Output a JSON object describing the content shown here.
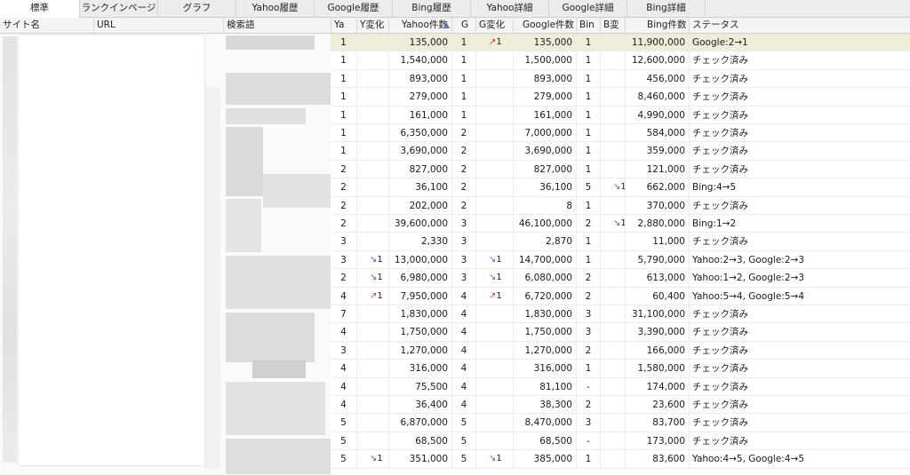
{
  "tabs": [
    "標準",
    "ランクインページ",
    "グラフ",
    "Yahoo履歴",
    "Google履歴",
    "Bing履歴",
    "Yahoo詳細",
    "Google詳細",
    "Bing詳細"
  ],
  "columns": {
    "site_name": "サイト名",
    "url": "URL",
    "keyword": "検索語",
    "yahoo_rank": "Ya",
    "yahoo_change": "Y変化",
    "yahoo_count": "Yahoo件数",
    "google_rank": "G",
    "google_change": "G変化",
    "google_count": "Google件数",
    "bing_rank": "Bin",
    "bing_change": "B変",
    "bing_count": "Bing件数",
    "status": "ステータス"
  },
  "rows": [
    {
      "ya": "1",
      "yc": "",
      "ycd": "",
      "yn": "135,000",
      "g": "1",
      "gc": "1",
      "gcd": "up",
      "gn": "135,000",
      "b": "1",
      "bc": "",
      "bcd": "",
      "bn": "11,900,000",
      "st": "Google:2→1"
    },
    {
      "ya": "1",
      "yc": "",
      "ycd": "",
      "yn": "1,540,000",
      "g": "1",
      "gc": "",
      "gcd": "",
      "gn": "1,500,000",
      "b": "1",
      "bc": "",
      "bcd": "",
      "bn": "12,600,000",
      "st": "チェック済み"
    },
    {
      "ya": "1",
      "yc": "",
      "ycd": "",
      "yn": "893,000",
      "g": "1",
      "gc": "",
      "gcd": "",
      "gn": "893,000",
      "b": "1",
      "bc": "",
      "bcd": "",
      "bn": "456,000",
      "st": "チェック済み"
    },
    {
      "ya": "1",
      "yc": "",
      "ycd": "",
      "yn": "279,000",
      "g": "1",
      "gc": "",
      "gcd": "",
      "gn": "279,000",
      "b": "1",
      "bc": "",
      "bcd": "",
      "bn": "8,460,000",
      "st": "チェック済み"
    },
    {
      "ya": "1",
      "yc": "",
      "ycd": "",
      "yn": "161,000",
      "g": "1",
      "gc": "",
      "gcd": "",
      "gn": "161,000",
      "b": "1",
      "bc": "",
      "bcd": "",
      "bn": "4,990,000",
      "st": "チェック済み"
    },
    {
      "ya": "1",
      "yc": "",
      "ycd": "",
      "yn": "6,350,000",
      "g": "2",
      "gc": "",
      "gcd": "",
      "gn": "7,000,000",
      "b": "1",
      "bc": "",
      "bcd": "",
      "bn": "584,000",
      "st": "チェック済み"
    },
    {
      "ya": "1",
      "yc": "",
      "ycd": "",
      "yn": "3,690,000",
      "g": "2",
      "gc": "",
      "gcd": "",
      "gn": "3,690,000",
      "b": "1",
      "bc": "",
      "bcd": "",
      "bn": "359,000",
      "st": "チェック済み"
    },
    {
      "ya": "2",
      "yc": "",
      "ycd": "",
      "yn": "827,000",
      "g": "2",
      "gc": "",
      "gcd": "",
      "gn": "827,000",
      "b": "1",
      "bc": "",
      "bcd": "",
      "bn": "121,000",
      "st": "チェック済み"
    },
    {
      "ya": "2",
      "yc": "",
      "ycd": "",
      "yn": "36,100",
      "g": "2",
      "gc": "",
      "gcd": "",
      "gn": "36,100",
      "b": "5",
      "bc": "1",
      "bcd": "down",
      "bn": "662,000",
      "st": "Bing:4→5"
    },
    {
      "ya": "2",
      "yc": "",
      "ycd": "",
      "yn": "202,000",
      "g": "2",
      "gc": "",
      "gcd": "",
      "gn": "8",
      "b": "1",
      "bc": "",
      "bcd": "",
      "bn": "370,000",
      "st": "チェック済み"
    },
    {
      "ya": "2",
      "yc": "",
      "ycd": "",
      "yn": "39,600,000",
      "g": "3",
      "gc": "",
      "gcd": "",
      "gn": "46,100,000",
      "b": "2",
      "bc": "1",
      "bcd": "down",
      "bn": "2,880,000",
      "st": "Bing:1→2"
    },
    {
      "ya": "3",
      "yc": "",
      "ycd": "",
      "yn": "2,330",
      "g": "3",
      "gc": "",
      "gcd": "",
      "gn": "2,870",
      "b": "1",
      "bc": "",
      "bcd": "",
      "bn": "11,000",
      "st": "チェック済み"
    },
    {
      "ya": "3",
      "yc": "1",
      "ycd": "down",
      "yn": "13,000,000",
      "g": "3",
      "gc": "1",
      "gcd": "down",
      "gn": "14,700,000",
      "b": "1",
      "bc": "",
      "bcd": "",
      "bn": "5,790,000",
      "st": "Yahoo:2→3, Google:2→3"
    },
    {
      "ya": "2",
      "yc": "1",
      "ycd": "down",
      "yn": "6,980,000",
      "g": "3",
      "gc": "1",
      "gcd": "down",
      "gn": "6,080,000",
      "b": "2",
      "bc": "",
      "bcd": "",
      "bn": "613,000",
      "st": "Yahoo:1→2, Google:2→3"
    },
    {
      "ya": "4",
      "yc": "1",
      "ycd": "up",
      "yn": "7,950,000",
      "g": "4",
      "gc": "1",
      "gcd": "up",
      "gn": "6,720,000",
      "b": "2",
      "bc": "",
      "bcd": "",
      "bn": "60,400",
      "st": "Yahoo:5→4, Google:5→4"
    },
    {
      "ya": "7",
      "yc": "",
      "ycd": "",
      "yn": "1,830,000",
      "g": "4",
      "gc": "",
      "gcd": "",
      "gn": "1,830,000",
      "b": "3",
      "bc": "",
      "bcd": "",
      "bn": "31,100,000",
      "st": "チェック済み"
    },
    {
      "ya": "4",
      "yc": "",
      "ycd": "",
      "yn": "1,750,000",
      "g": "4",
      "gc": "",
      "gcd": "",
      "gn": "1,750,000",
      "b": "3",
      "bc": "",
      "bcd": "",
      "bn": "3,390,000",
      "st": "チェック済み"
    },
    {
      "ya": "3",
      "yc": "",
      "ycd": "",
      "yn": "1,270,000",
      "g": "4",
      "gc": "",
      "gcd": "",
      "gn": "1,270,000",
      "b": "2",
      "bc": "",
      "bcd": "",
      "bn": "166,000",
      "st": "チェック済み"
    },
    {
      "ya": "4",
      "yc": "",
      "ycd": "",
      "yn": "316,000",
      "g": "4",
      "gc": "",
      "gcd": "",
      "gn": "316,000",
      "b": "1",
      "bc": "",
      "bcd": "",
      "bn": "1,580,000",
      "st": "チェック済み"
    },
    {
      "ya": "4",
      "yc": "",
      "ycd": "",
      "yn": "75,500",
      "g": "4",
      "gc": "",
      "gcd": "",
      "gn": "81,100",
      "b": "-",
      "bc": "",
      "bcd": "",
      "bn": "174,000",
      "st": "チェック済み"
    },
    {
      "ya": "4",
      "yc": "",
      "ycd": "",
      "yn": "36,400",
      "g": "4",
      "gc": "",
      "gcd": "",
      "gn": "38,300",
      "b": "2",
      "bc": "",
      "bcd": "",
      "bn": "23,600",
      "st": "チェック済み"
    },
    {
      "ya": "5",
      "yc": "",
      "ycd": "",
      "yn": "6,870,000",
      "g": "5",
      "gc": "",
      "gcd": "",
      "gn": "8,470,000",
      "b": "3",
      "bc": "",
      "bcd": "",
      "bn": "83,700",
      "st": "チェック済み"
    },
    {
      "ya": "5",
      "yc": "",
      "ycd": "",
      "yn": "68,500",
      "g": "5",
      "gc": "",
      "gcd": "",
      "gn": "68,500",
      "b": "-",
      "bc": "",
      "bcd": "",
      "bn": "173,000",
      "st": "チェック済み"
    },
    {
      "ya": "5",
      "yc": "1",
      "ycd": "down",
      "yn": "351,000",
      "g": "5",
      "gc": "1",
      "gcd": "down",
      "gn": "385,000",
      "b": "1",
      "bc": "",
      "bcd": "",
      "bn": "83,600",
      "st": "Yahoo:4→5, Google:4→5"
    }
  ],
  "colors": {
    "selected_row": "#efecd9",
    "arrow_up": "#d23a3a",
    "arrow_down": "#2f6fd0"
  },
  "icons": {
    "arrow_up": "↗",
    "arrow_down": "↘",
    "sort": "▲"
  }
}
